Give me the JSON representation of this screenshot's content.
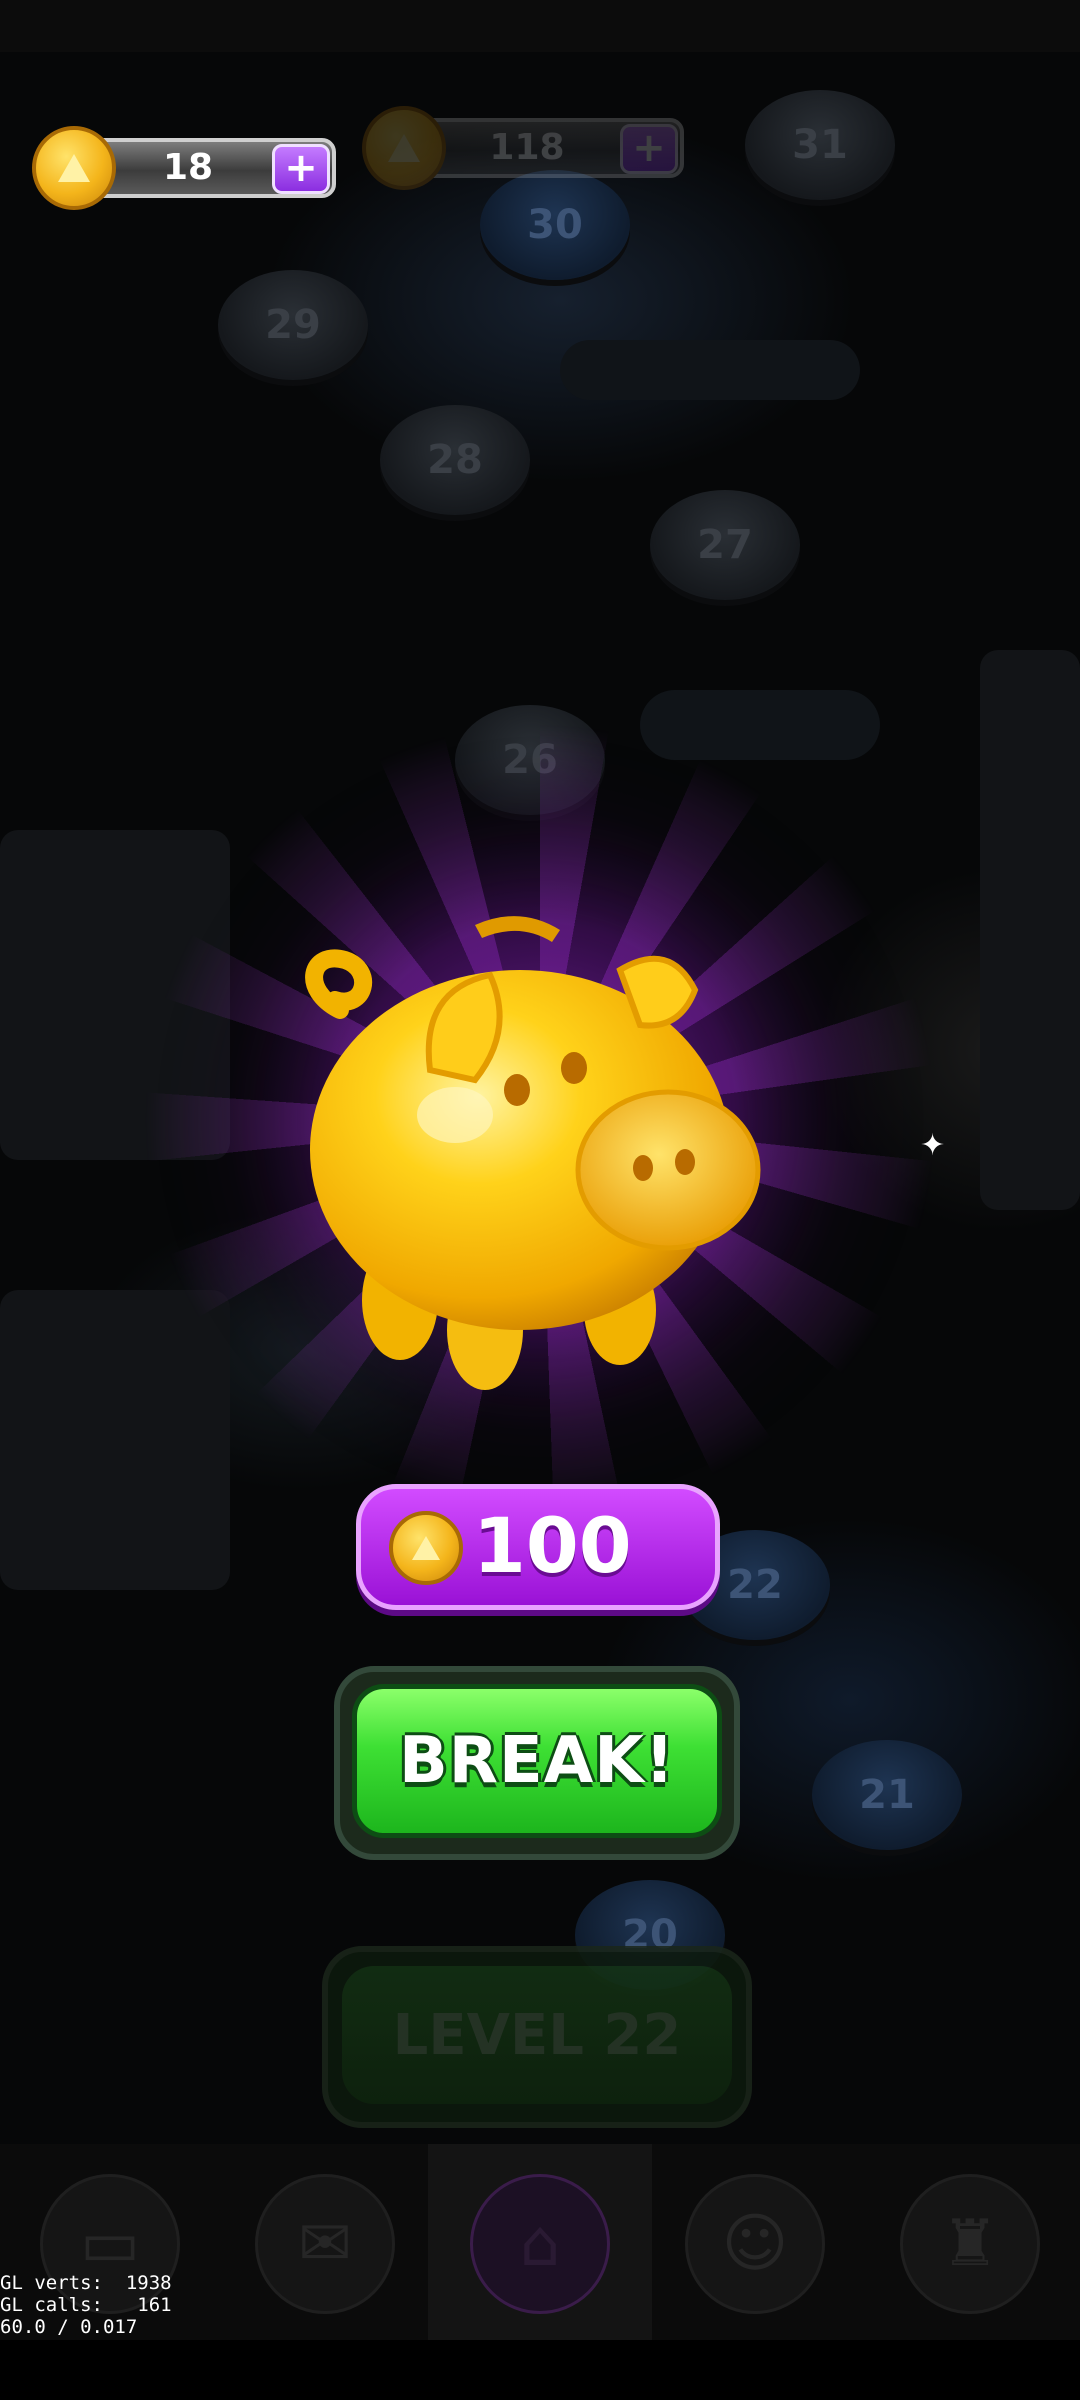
{
  "coins": {
    "count": "18",
    "plus_label": "+"
  },
  "secondary_counter": {
    "count": "118",
    "plus_label": "+"
  },
  "map_levels": [
    "31",
    "30",
    "29",
    "28",
    "27",
    "26",
    "22",
    "21",
    "20"
  ],
  "reward": {
    "amount": "100"
  },
  "break_button": {
    "label": "BREAK!"
  },
  "level_button": {
    "label": "LEVEL 22"
  },
  "nav": {
    "items": [
      {
        "name": "cards",
        "icon": "cards-icon"
      },
      {
        "name": "mail",
        "icon": "envelope-icon"
      },
      {
        "name": "home",
        "icon": "home-icon",
        "active": true
      },
      {
        "name": "team",
        "icon": "people-icon"
      },
      {
        "name": "leaderboard",
        "icon": "trophy-icon"
      }
    ]
  },
  "debug": {
    "gl_verts": "GL verts:  1938",
    "gl_calls": "GL calls:   161",
    "fps": "60.0 / 0.017"
  },
  "colors": {
    "accent_purple": "#a81fe0",
    "button_green": "#3ee034",
    "coin_gold": "#f4b51b",
    "pig_yellow": "#ffd21a"
  }
}
